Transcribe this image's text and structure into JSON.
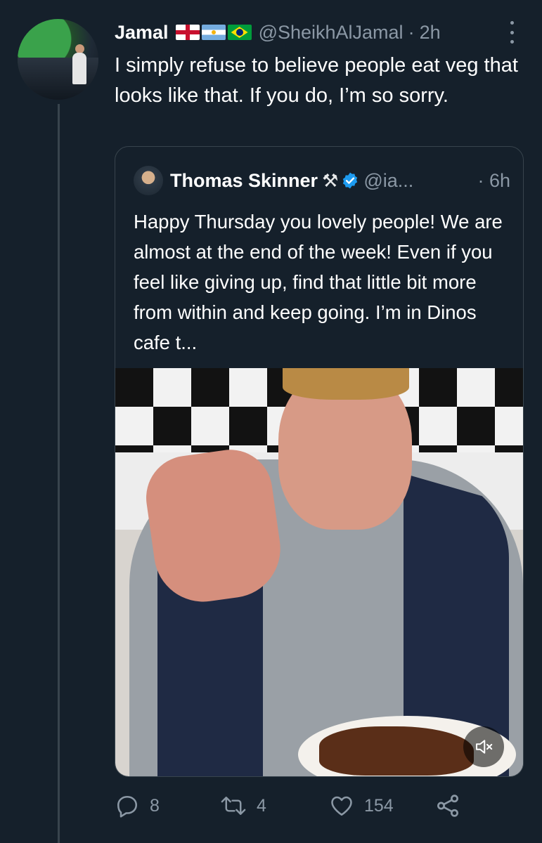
{
  "tweet": {
    "author_name": "Jamal",
    "handle": "@SheikhAlJamal",
    "separator": "·",
    "time": "2h",
    "text": "I simply refuse to believe people eat veg that looks like that. If you do, I’m so sorry."
  },
  "quoted_tweet": {
    "author_name": "Thomas Skinner",
    "badge": "⚒",
    "handle": "@ia...",
    "time": "· 6h",
    "text": "Happy Thursday you lovely people! We are almost at the end of the week! Even if you feel like giving up, find that little bit more from within and keep going. I’m in Dinos cafe t..."
  },
  "actions": {
    "replies": "8",
    "retweets": "4",
    "likes": "154"
  },
  "colors": {
    "background": "#15202b",
    "muted_text": "#8b98a5",
    "verified": "#1d9bf0",
    "border": "#38444d"
  },
  "icons": [
    "more-icon",
    "hammer-icon",
    "verified-icon",
    "mute-icon",
    "reply-icon",
    "retweet-icon",
    "like-icon",
    "share-icon"
  ]
}
